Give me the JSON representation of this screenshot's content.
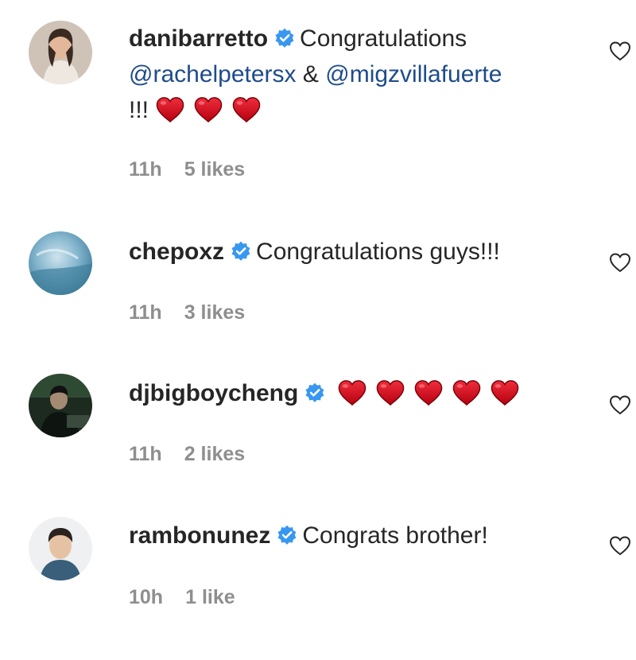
{
  "comments": [
    {
      "username": "danibarretto",
      "text_prefix": "Congratulations",
      "mention1": "@rachelpetersx",
      "connector": "&",
      "mention2": "@migzvillafuerte",
      "suffix": "!!!",
      "heart_count": 3,
      "time": "11h",
      "likes": "5 likes"
    },
    {
      "username": "chepoxz",
      "text": "Congratulations guys!!!",
      "time": "11h",
      "likes": "3 likes"
    },
    {
      "username": "djbigboycheng",
      "heart_count": 5,
      "time": "11h",
      "likes": "2 likes"
    },
    {
      "username": "rambonunez",
      "text": "Congrats brother!",
      "time": "10h",
      "likes": "1 like"
    }
  ],
  "colors": {
    "verified": "#3897f0",
    "mention": "#1e4c8a",
    "heart": "#d0021b",
    "meta": "#8e8e8e"
  },
  "icons": {
    "verified": "verified-badge-icon",
    "like": "heart-outline-icon",
    "emoji": "red-heart-emoji-icon"
  }
}
